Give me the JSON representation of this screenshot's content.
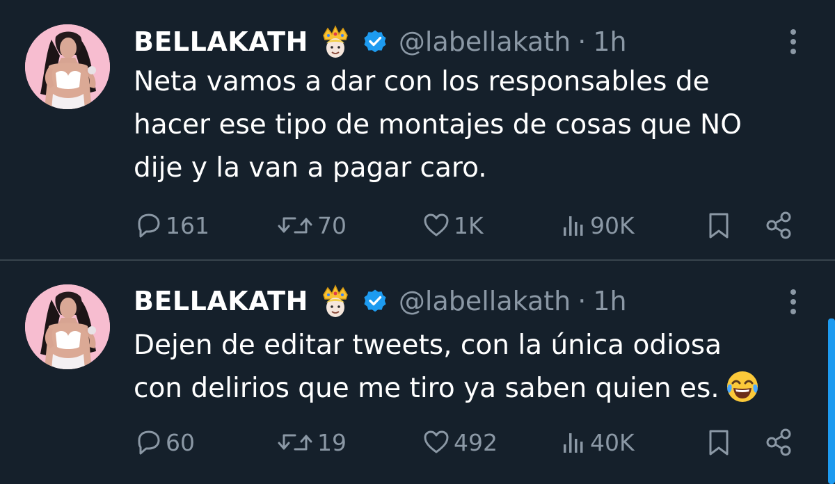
{
  "colors": {
    "background": "#15202b",
    "text_primary": "#ffffff",
    "text_secondary": "#8b98a5",
    "accent": "#1d9bf0",
    "divider": "#38444d"
  },
  "tweets": [
    {
      "author": {
        "display_name": "BELLAKATH",
        "badge_emoji": "crown-emoji",
        "verified": true,
        "handle": "@labellakath",
        "separator": "·",
        "time": "1h"
      },
      "text_lines": [
        "Neta vamos a dar con los responsables de",
        "hacer ese tipo de montajes de cosas que NO",
        "dije y la van a pagar caro."
      ],
      "trailing_emoji": "",
      "stats": {
        "replies": "161",
        "retweets": "70",
        "likes": "1K",
        "views": "90K"
      },
      "icons": [
        "reply-icon",
        "retweet-icon",
        "like-icon",
        "views-icon",
        "bookmark-icon",
        "share-icon",
        "more-icon"
      ]
    },
    {
      "author": {
        "display_name": "BELLAKATH",
        "badge_emoji": "crown-emoji",
        "verified": true,
        "handle": "@labellakath",
        "separator": "·",
        "time": "1h"
      },
      "text_lines": [
        "Dejen de editar tweets, con la única odiosa",
        "con delirios que me tiro ya saben quien es."
      ],
      "trailing_emoji": "laughing-crying-emoji",
      "stats": {
        "replies": "60",
        "retweets": "19",
        "likes": "492",
        "views": "40K"
      },
      "icons": [
        "reply-icon",
        "retweet-icon",
        "like-icon",
        "views-icon",
        "bookmark-icon",
        "share-icon",
        "more-icon"
      ]
    }
  ]
}
